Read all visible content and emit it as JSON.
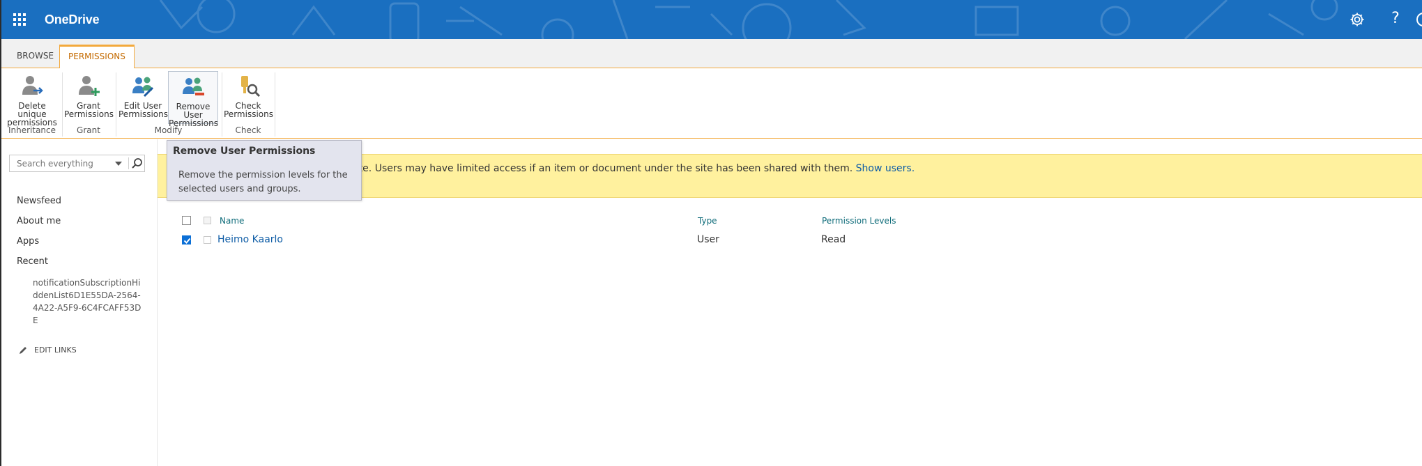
{
  "suite": {
    "app_name": "OneDrive",
    "help_glyph": "?",
    "bar_color": "#1a6fc0",
    "icons": [
      "app-launcher-icon",
      "gear-icon",
      "help-icon"
    ]
  },
  "ribbon": {
    "tabs": [
      {
        "label": "BROWSE",
        "active": false
      },
      {
        "label": "PERMISSIONS",
        "active": true
      }
    ],
    "buttons": [
      {
        "label": "Delete unique\npermissions",
        "icon": "delete-permissions-icon",
        "group": "Inheritance"
      },
      {
        "label": "Grant\nPermissions",
        "icon": "grant-permissions-icon",
        "group": "Grant"
      },
      {
        "label": "Edit User\nPermissions",
        "icon": "edit-user-permissions-icon",
        "group": "Modify"
      },
      {
        "label": "Remove User\nPermissions",
        "icon": "remove-user-permissions-icon",
        "group": "Modify",
        "selected": true
      },
      {
        "label": "Check\nPermissions",
        "icon": "check-permissions-icon",
        "group": "Check"
      }
    ],
    "groups": [
      "Inheritance",
      "Grant",
      "Modify",
      "Check"
    ],
    "accent": "#f3a93c"
  },
  "tooltip": {
    "title": "Remove User Permissions",
    "body": "Remove the permission levels for the selected users and groups."
  },
  "leftnav": {
    "search_placeholder": "Search everything",
    "links": [
      "Newsfeed",
      "About me",
      "Apps",
      "Recent"
    ],
    "recent_item": "notificationSubscriptionHiddenList6D1E55DA-2564-4A22-A5F9-6C4FCAFF53DE",
    "edit_links": "EDIT LINKS"
  },
  "banner": {
    "message": "his site. Users may have limited access if an item or document under the site has been shared with them.",
    "link": "Show users.",
    "color": "#fff19e"
  },
  "table": {
    "headers": [
      "Name",
      "Type",
      "Permission Levels"
    ],
    "rows": [
      {
        "name": "Heimo Kaarlo",
        "type": "User",
        "permission": "Read",
        "selected": true
      }
    ]
  }
}
